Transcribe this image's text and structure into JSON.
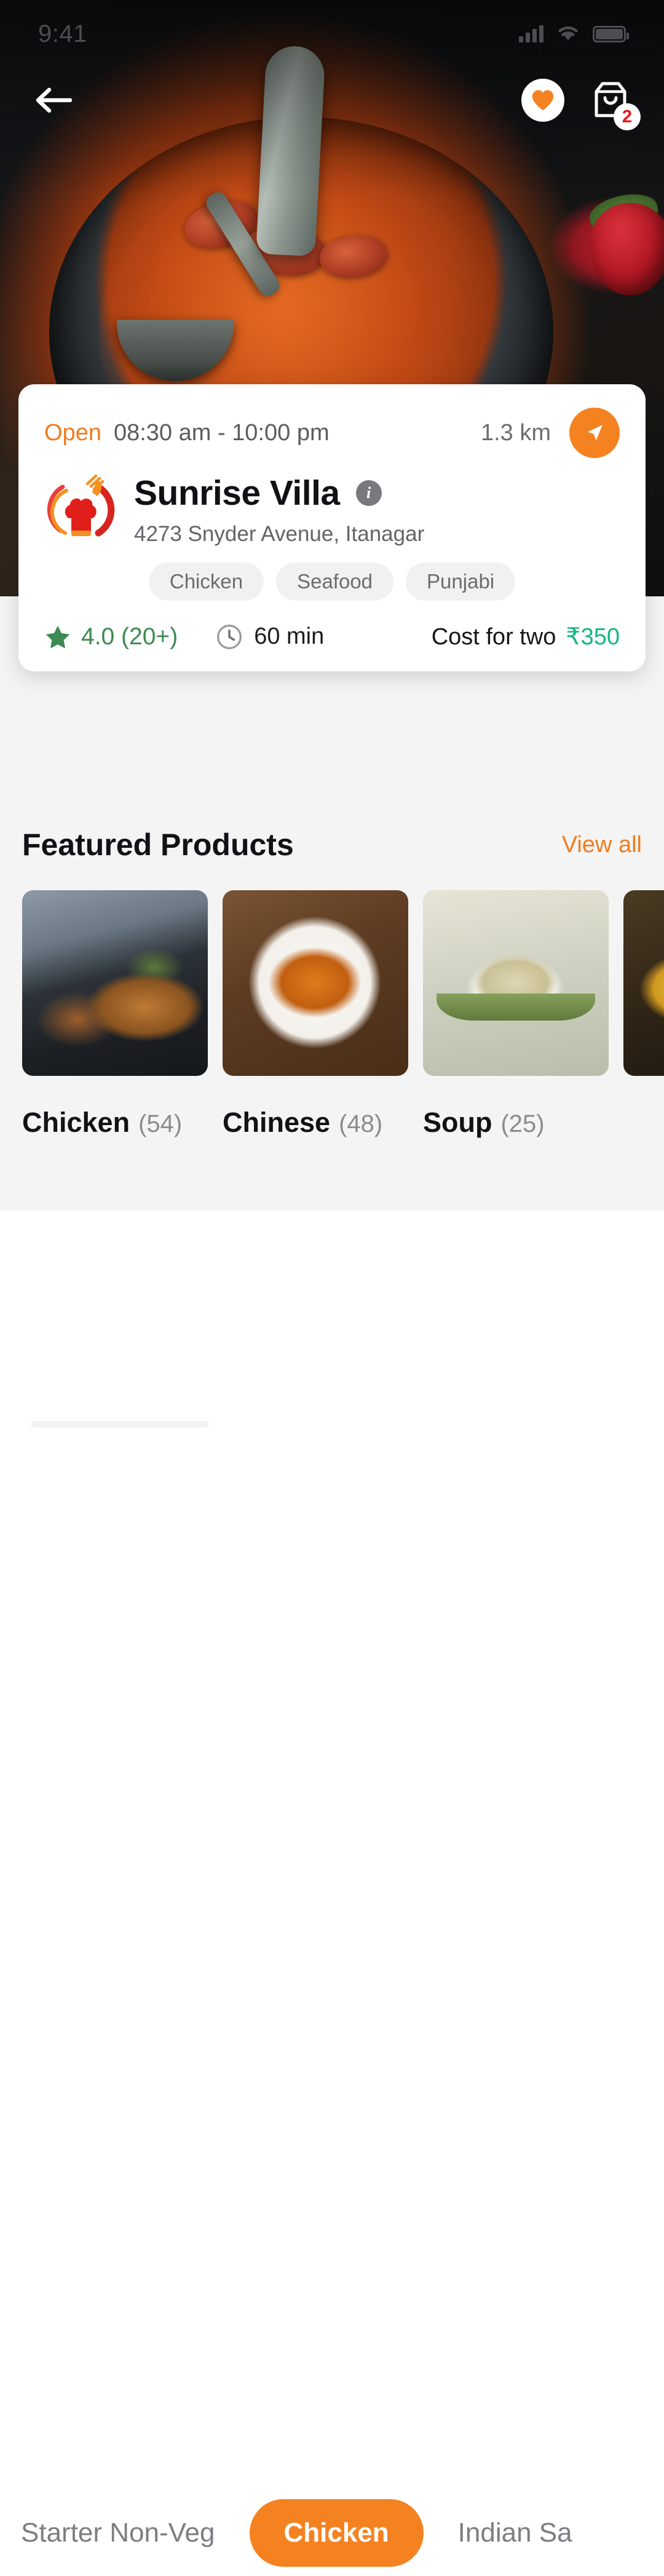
{
  "status_bar": {
    "time": "9:41",
    "signal_icon": "cellular-signal-icon",
    "wifi_icon": "wifi-icon",
    "battery_icon": "battery-full-icon"
  },
  "header": {
    "back_icon": "back-arrow-icon",
    "favorite_icon": "heart-icon",
    "cart_icon": "shopping-bag-icon",
    "cart_badge_count": "2"
  },
  "hero": {
    "image_alt": "bowl-of-soup-with-spoon-and-strawberries",
    "accent_color": "#f58220"
  },
  "info_card": {
    "status_label": "Open",
    "hours": "08:30 am - 10:00 pm",
    "distance": "1.3 km",
    "navigate_icon": "navigation-arrow-icon",
    "logo_icon": "chef-hat-logo-icon",
    "restaurant_name": "Sunrise Villa",
    "info_icon": "info-icon",
    "address": "4273 Snyder Avenue, Itanagar",
    "tags": [
      "Chicken",
      "Seafood",
      "Punjabi"
    ],
    "rating_icon": "star-icon",
    "rating": "4.0 (20+)",
    "time_icon": "clock-icon",
    "delivery_time": "60 min",
    "cost_label": "Cost for two",
    "cost_value": "₹350",
    "status_color": "#f07c1f",
    "rating_color": "#3d8a52",
    "cost_color": "#12b981"
  },
  "featured": {
    "title": "Featured Products",
    "view_all_label": "View all",
    "products": [
      {
        "name": "Chicken",
        "count": "(54)",
        "image_alt": "roasted-chicken-skillet"
      },
      {
        "name": "Chinese",
        "count": "(48)",
        "image_alt": "chinese-noodles-plate"
      },
      {
        "name": "Soup",
        "count": "(25)",
        "image_alt": "corn-vegetable-soup-bowl"
      },
      {
        "name": "",
        "count": "",
        "image_alt": "partial-food-card"
      }
    ]
  },
  "categories": {
    "items": [
      {
        "label": "Starter Non-Veg",
        "active": false
      },
      {
        "label": "Chicken",
        "active": true
      },
      {
        "label": "Indian Sa",
        "active": false
      }
    ],
    "active_color": "#f58220"
  }
}
